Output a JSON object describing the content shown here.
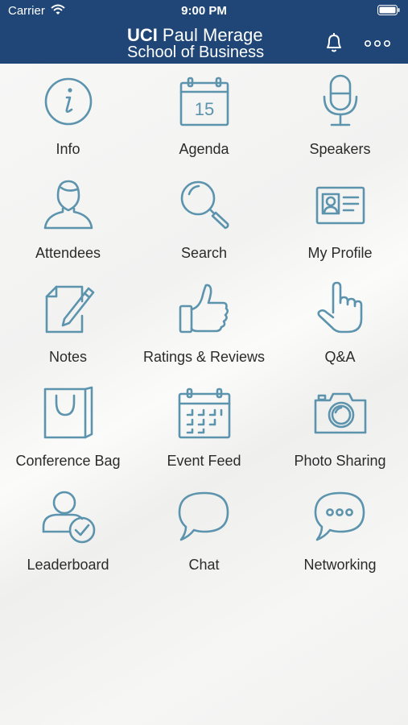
{
  "status": {
    "carrier": "Carrier",
    "time": "9:00 PM"
  },
  "header": {
    "logo_uci": "UCI",
    "logo_name": "Paul Merage",
    "logo_sub": "School of Business"
  },
  "icon_color": "#5c93ad",
  "header_color": "#1f4676",
  "menu": [
    {
      "label": "Info",
      "icon": "info-icon"
    },
    {
      "label": "Agenda",
      "icon": "calendar-15-icon",
      "icon_text": "15"
    },
    {
      "label": "Speakers",
      "icon": "microphone-icon"
    },
    {
      "label": "Attendees",
      "icon": "person-icon"
    },
    {
      "label": "Search",
      "icon": "magnifier-icon"
    },
    {
      "label": "My Profile",
      "icon": "id-card-icon"
    },
    {
      "label": "Notes",
      "icon": "note-pencil-icon"
    },
    {
      "label": "Ratings & Reviews",
      "icon": "thumbs-up-icon"
    },
    {
      "label": "Q&A",
      "icon": "pointing-hand-icon"
    },
    {
      "label": "Conference Bag",
      "icon": "bag-icon"
    },
    {
      "label": "Event Feed",
      "icon": "calendar-grid-icon"
    },
    {
      "label": "Photo Sharing",
      "icon": "camera-icon"
    },
    {
      "label": "Leaderboard",
      "icon": "user-check-icon"
    },
    {
      "label": "Chat",
      "icon": "speech-bubble-icon"
    },
    {
      "label": "Networking",
      "icon": "speech-bubble-dots-icon"
    }
  ]
}
